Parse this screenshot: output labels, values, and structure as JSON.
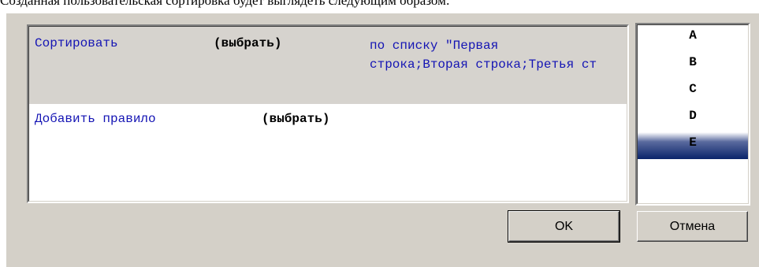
{
  "caption": "Созданная пользовательская сортировка будет выглядеть следующим образом:",
  "rules": {
    "sort_label": "Сортировать",
    "sort_choose": "(выбрать)",
    "sort_list_value": "по списку \"Первая строка;Вторая строка;Третья ст",
    "add_rule_label": "Добавить правило",
    "add_rule_choose": "(выбрать)"
  },
  "list": {
    "items": [
      "A",
      "B",
      "C",
      "D",
      "E"
    ],
    "selected": "E"
  },
  "buttons": {
    "ok": "OK",
    "cancel": "Отмена"
  },
  "colors": {
    "link_blue": "#1414b4",
    "selection": "#0a246a",
    "dialog_bg": "#d4d0c8"
  }
}
